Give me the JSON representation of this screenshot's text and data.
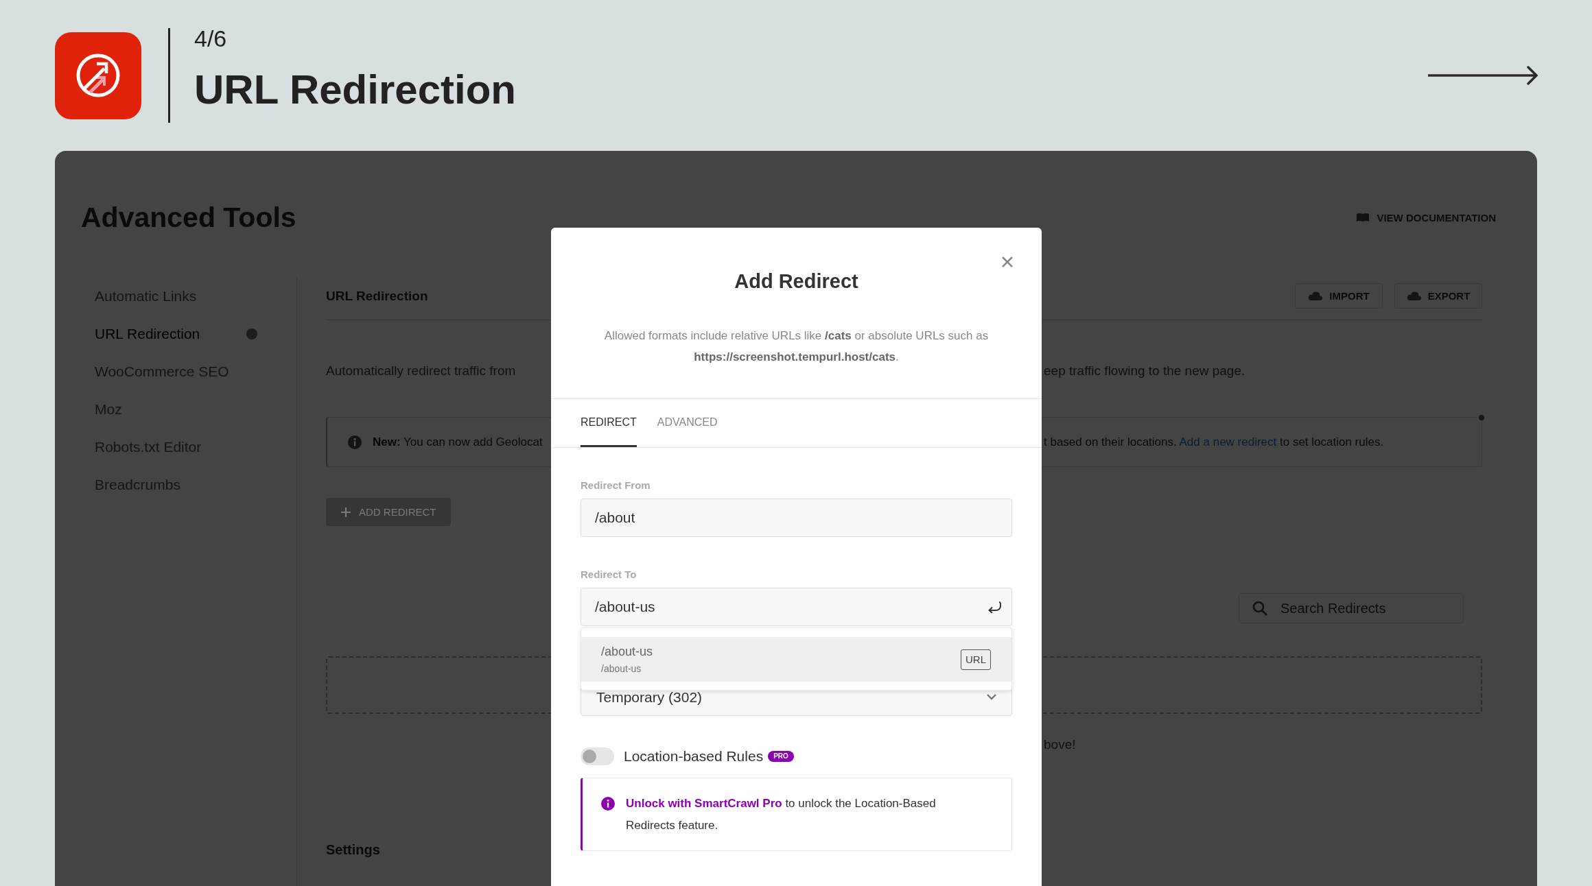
{
  "header": {
    "step": "4/6",
    "title": "URL Redirection"
  },
  "background": {
    "page_title": "Advanced Tools",
    "documentation_link": "VIEW DOCUMENTATION",
    "sidebar": {
      "items": [
        {
          "label": "Automatic Links",
          "selected": false
        },
        {
          "label": "URL Redirection",
          "selected": true
        },
        {
          "label": "WooCommerce SEO",
          "selected": false
        },
        {
          "label": "Moz",
          "selected": false
        },
        {
          "label": "Robots.txt Editor",
          "selected": false
        },
        {
          "label": "Breadcrumbs",
          "selected": false
        }
      ]
    },
    "section": {
      "title": "URL Redirection",
      "buttons": [
        {
          "label": "IMPORT"
        },
        {
          "label": "EXPORT"
        }
      ],
      "description": {
        "visible_start": "Automatically redirect traffic from",
        "visible_end": "eep traffic flowing to the new page."
      },
      "notice": {
        "visible_start": "**New:** You can now add Geolocat",
        "visible_end": "t based on their locations.",
        "link": "Add a new redirect",
        "text_after_link": "to set location rules."
      },
      "add_button": "ADD REDIRECT",
      "search": {
        "placeholder": "Search Redirects"
      },
      "empty_hint": "bove!",
      "settings_title": "Settings"
    }
  },
  "modal": {
    "title": "Add Redirect",
    "description": "Allowed formats include relative URLs like **/cats** or absolute URLs such as **https://screenshot.tempurl.host/cats**.",
    "tabs": [
      {
        "label": "REDIRECT",
        "selected": true
      },
      {
        "label": "ADVANCED",
        "selected": false
      }
    ],
    "redirect_from": {
      "label": "Redirect From",
      "value": "/about"
    },
    "redirect_to": {
      "label": "Redirect To",
      "value": "/about-us"
    },
    "suggestions": [
      {
        "title": "/about-us",
        "subtitle": "/about-us",
        "tag": "URL",
        "selected": true
      }
    ],
    "redirect_type": {
      "value": "Temporary (302)"
    },
    "location_rules": {
      "label": "Location-based Rules",
      "badge": "PRO",
      "on": false
    },
    "upsell": {
      "link": "Unlock with SmartCrawl Pro",
      "text": "to unlock the Location-Based Redirects feature."
    }
  }
}
